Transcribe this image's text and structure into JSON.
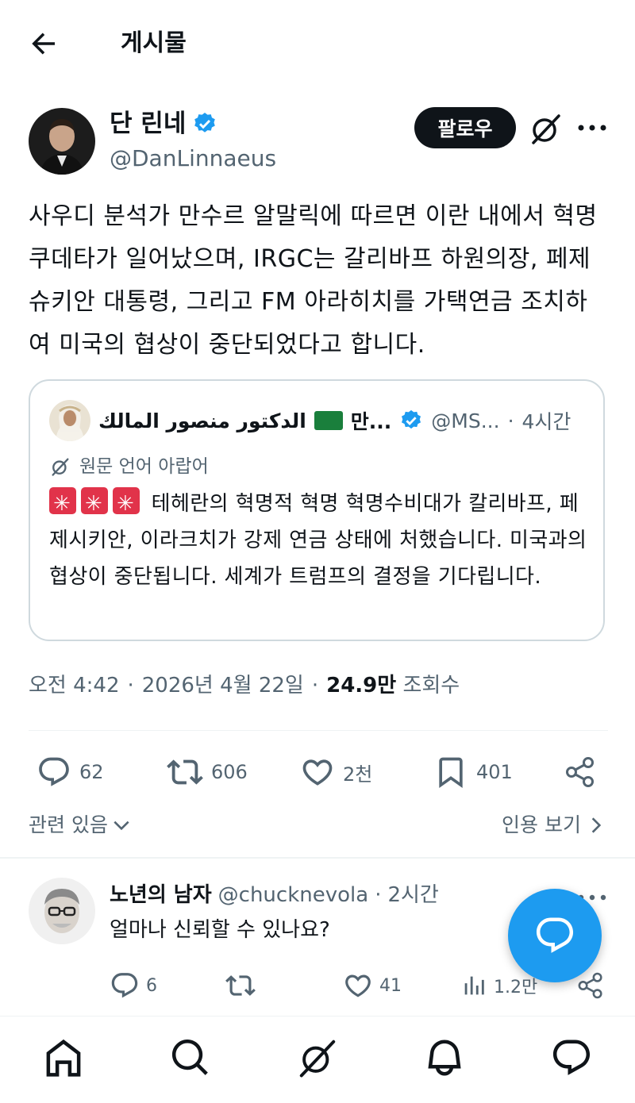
{
  "header": {
    "title": "게시물"
  },
  "author": {
    "name": "단 린네",
    "handle": "@DanLinnaeus",
    "follow_label": "팔로우"
  },
  "tweet": {
    "text": "사우디 분석가 만수르 알말릭에 따르면 이란 내에서 혁명 쿠데타가 일어났으며, IRGC는 갈리바프 하원의장, 페제슈키안 대통령, 그리고 FM 아라히치를 가택연금 조치하여 미국의 협상이 중단되었다고 합니다."
  },
  "quote": {
    "name": "الدكتور منصور المالك",
    "name_suffix": "만...",
    "handle": "@MS...",
    "separator": "·",
    "time": "4시간",
    "lang_note": "원문 언어 아랍어",
    "text": "테헤란의 혁명적 혁명 혁명수비대가 칼리바프, 페제시키안, 이라크치가 강제 연금 상태에 처했습니다. 미국과의 협상이 중단됩니다. 세계가 트럼프의 결정을 기다립니다."
  },
  "meta": {
    "time": "오전 4:42",
    "sep1": "·",
    "date": "2026년 4월 22일",
    "sep2": "·",
    "views": "24.9만",
    "views_label": "조회수"
  },
  "actions": {
    "replies": "62",
    "reposts": "606",
    "likes": "2천",
    "bookmarks": "401"
  },
  "related": {
    "related_label": "관련 있음",
    "quotes_label": "인용 보기"
  },
  "reply": {
    "name": "노년의 남자",
    "handle": "@chucknevola",
    "separator": "·",
    "time": "2시간",
    "text": "얼마나 신뢰할 수 있나요?",
    "replies": "6",
    "likes": "41",
    "views": "1.2만"
  },
  "colors": {
    "accent": "#1d9bf0",
    "text": "#0f1419",
    "muted": "#536471",
    "border": "#cfd9de"
  },
  "icons": [
    "back-arrow-icon",
    "verified-icon",
    "grok-icon",
    "more-icon",
    "reply-icon",
    "repost-icon",
    "like-icon",
    "bookmark-icon",
    "share-icon",
    "chevron-down-icon",
    "chevron-right-icon",
    "views-icon",
    "compose-icon",
    "home-icon",
    "search-icon",
    "notifications-icon",
    "messages-icon"
  ]
}
